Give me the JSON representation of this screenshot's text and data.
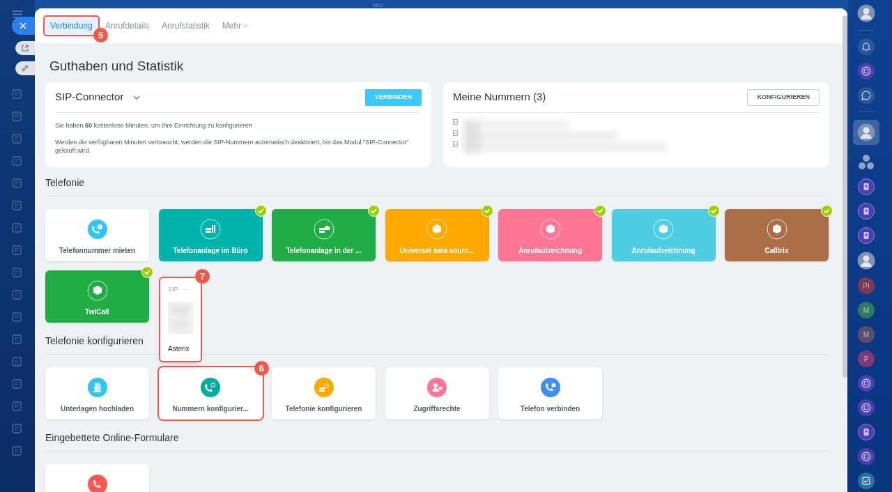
{
  "top_label": "NEU",
  "tabs": [
    {
      "label": "Verbindung",
      "selected": true,
      "annotation": "5"
    },
    {
      "label": "Anrufdetails",
      "selected": false
    },
    {
      "label": "Anrufstatistik",
      "selected": false
    },
    {
      "label": "Mehr",
      "selected": false,
      "dropdown": true
    }
  ],
  "title": "Guthaben und Statistik",
  "sip_card": {
    "title": "SIP-Connector",
    "button": "VERBINDEN",
    "lines": [
      "Sie haben **60** kostenlose Minuten, um Ihre Einrichtung zu konfigurieren",
      "Werden die verfügbaren Minuten verbraucht, werden die SIP-Nummern automatisch deaktiviert, bis das Modul \"SIP-Connector\" gekauft wird."
    ]
  },
  "numbers_card": {
    "title": "Meine Nummern (3)",
    "button": "KONFIGURIEREN"
  },
  "sections": [
    {
      "heading": "Telefonie",
      "tiles": [
        {
          "label": "Telefonnummer mieten",
          "kind": "plain",
          "color": "#2fc6f6",
          "connected": false
        },
        {
          "label": "Telefonanlage im Büro",
          "kind": "filled",
          "color": "#00b4ac",
          "connected": true
        },
        {
          "label": "Telefonanlage in der ...",
          "kind": "filled",
          "color": "#21ad46",
          "connected": true
        },
        {
          "label": "Universal data sourc...",
          "kind": "filled",
          "color": "#ffa900",
          "connected": true
        },
        {
          "label": "Anrufaufzeichnung",
          "kind": "filled",
          "color": "#ff7596",
          "connected": true
        },
        {
          "label": "Anrufaufzeichnung",
          "kind": "filled",
          "color": "#4fcde2",
          "connected": true
        },
        {
          "label": "Calltrix",
          "kind": "filled",
          "color": "#ab6e48",
          "connected": true
        },
        {
          "label": "TwiCall",
          "kind": "filled",
          "color": "#21ad46",
          "connected": true
        }
      ]
    },
    {
      "heading": "Telefonie konfigurieren",
      "tiles": [
        {
          "label": "Unterlagen hochladen",
          "kind": "plain",
          "color": "#2fc6f6",
          "connected": false
        },
        {
          "label": "Nummern konfigurier...",
          "kind": "plain",
          "color": "#00ada1",
          "connected": false,
          "annotation": "6"
        },
        {
          "label": "Telefonie konfigurieren",
          "kind": "plain",
          "color": "#ffa900",
          "connected": false
        },
        {
          "label": "Zugriffsrechte",
          "kind": "plain",
          "color": "#ff7596",
          "connected": false
        },
        {
          "label": "Telefon verbinden",
          "kind": "plain",
          "color": "#3e8ff0",
          "connected": false
        }
      ]
    },
    {
      "heading": "Eingebettete Online-Formulare",
      "tiles": [
        {
          "kind": "plain",
          "color": "#ff5752",
          "connected": false
        }
      ]
    }
  ],
  "sip_popup": {
    "title": "SIP",
    "item": "Asterix",
    "annotation": "7"
  },
  "right_bar": [
    {
      "kind": "avatar"
    },
    {
      "kind": "bell"
    },
    {
      "kind": "swirl"
    },
    {
      "kind": "chat"
    },
    {
      "kind": "avatar",
      "selected": true
    },
    {
      "kind": "group"
    },
    {
      "kind": "contact"
    },
    {
      "kind": "contact"
    },
    {
      "kind": "contact"
    },
    {
      "kind": "avatar"
    },
    {
      "kind": "letter",
      "text": "PI",
      "color": "#7a3a55"
    },
    {
      "kind": "letter",
      "text": "M",
      "color": "#2c7a62"
    },
    {
      "kind": "letter",
      "text": "M",
      "color": "#5a4e6e"
    },
    {
      "kind": "letter",
      "text": "P",
      "color": "#7c3a78"
    },
    {
      "kind": "swirl"
    },
    {
      "kind": "swirl"
    },
    {
      "kind": "contact"
    },
    {
      "kind": "swirl"
    },
    {
      "kind": "check"
    }
  ]
}
